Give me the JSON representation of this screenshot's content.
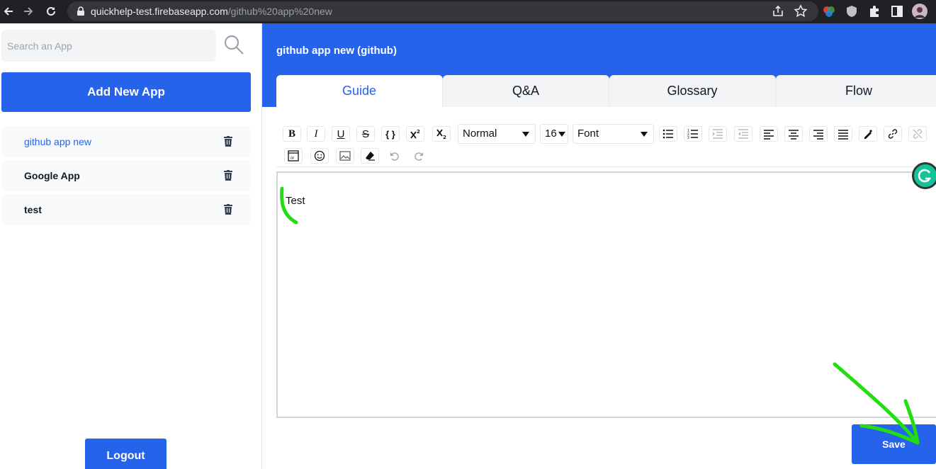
{
  "browser": {
    "url_host": "quickhelp-test.firebaseapp.com",
    "url_path": "/github%20app%20new"
  },
  "sidebar": {
    "search_placeholder": "Search an App",
    "add_button_label": "Add New App",
    "apps": [
      {
        "name": "github app new",
        "active": true
      },
      {
        "name": "Google App",
        "active": false
      },
      {
        "name": "test",
        "active": false
      }
    ],
    "logout_label": "Logout"
  },
  "main": {
    "app_title": "github app new (github)",
    "tabs": [
      "Guide",
      "Q&A",
      "Glossary",
      "Flow"
    ],
    "active_tab": "Guide",
    "toolbar": {
      "format_select": "Normal",
      "size_select": "16",
      "font_select": "Font"
    },
    "editor_content": "Test",
    "save_label": "Save"
  },
  "colors": {
    "accent": "#2563eb",
    "annotation": "#22dd11"
  }
}
